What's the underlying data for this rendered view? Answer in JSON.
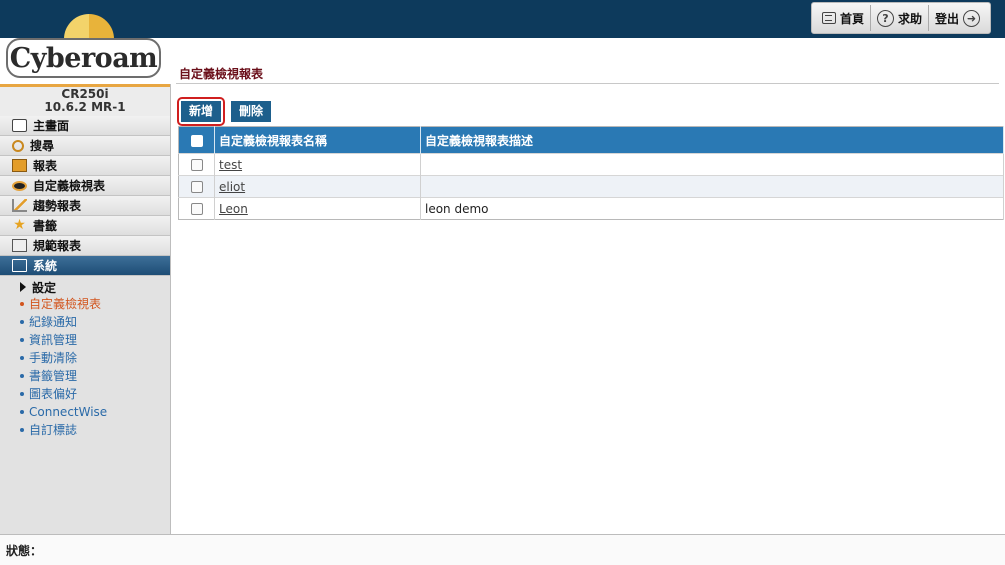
{
  "header": {
    "links": [
      {
        "label": "首頁",
        "icon": "home-icon"
      },
      {
        "label": "求助",
        "icon": "help-icon"
      },
      {
        "label": "登出",
        "icon": "logout-icon"
      }
    ]
  },
  "logo": {
    "text": "Cyberoam"
  },
  "device": {
    "model": "CR250i",
    "version": "10.6.2 MR-1"
  },
  "sidebar": {
    "items": [
      {
        "label": "主畫面",
        "icon": "dashboard-icon"
      },
      {
        "label": "搜尋",
        "icon": "search-icon"
      },
      {
        "label": "報表",
        "icon": "report-icon"
      },
      {
        "label": "自定義檢視表",
        "icon": "eye-icon"
      },
      {
        "label": "趨勢報表",
        "icon": "trend-icon"
      },
      {
        "label": "書籤",
        "icon": "star-icon"
      },
      {
        "label": "規範報表",
        "icon": "clipboard-icon"
      },
      {
        "label": "系統",
        "icon": "monitor-icon",
        "active": true
      }
    ],
    "submenu": {
      "heading": "設定",
      "items": [
        "自定義檢視表",
        "紀錄通知",
        "資訊管理",
        "手動清除",
        "書籤管理",
        "圖表偏好",
        "ConnectWise",
        "自訂標誌"
      ],
      "current": "自定義檢視表"
    }
  },
  "main": {
    "title": "自定義檢視報表",
    "buttons": {
      "add": "新增",
      "delete": "刪除"
    },
    "table": {
      "columns": [
        "自定義檢視報表名稱",
        "自定義檢視報表描述"
      ],
      "rows": [
        {
          "name": "test",
          "description": ""
        },
        {
          "name": "eliot",
          "description": ""
        },
        {
          "name": "Leon",
          "description": "leon demo"
        }
      ]
    }
  },
  "status": {
    "label": "狀態："
  },
  "colors": {
    "banner": "#0d3a5c",
    "button": "#1d5f8c",
    "table_header": "#2a79b4",
    "highlight": "#d01f1f",
    "active_link": "#d2551e"
  }
}
